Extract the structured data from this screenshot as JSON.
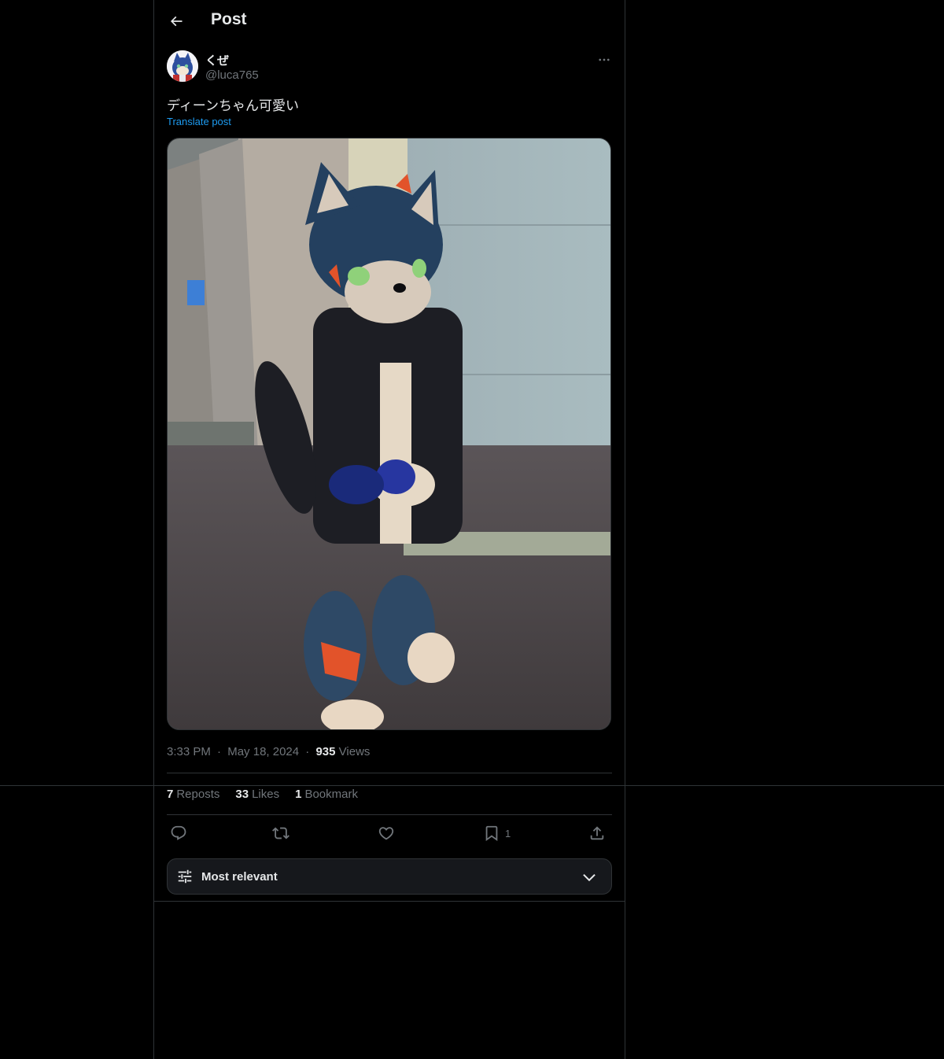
{
  "header": {
    "title": "Post"
  },
  "author": {
    "display_name": "くぜ",
    "handle": "@luca765"
  },
  "post": {
    "text": "ディーンちゃん可愛い",
    "translate_label": "Translate post",
    "time": "3:33 PM",
    "date": "May 18, 2024",
    "separator": "·",
    "views_count": "935",
    "views_label": "Views"
  },
  "stats": {
    "reposts_count": "7",
    "reposts_label": "Reposts",
    "likes_count": "33",
    "likes_label": "Likes",
    "bookmarks_count": "1",
    "bookmarks_label": "Bookmark"
  },
  "actions": {
    "bookmark_count": "1"
  },
  "sort": {
    "label": "Most relevant"
  },
  "colors": {
    "accent": "#1d9bf0",
    "background": "#000000",
    "border": "#2f3336",
    "muted": "#71767b"
  }
}
